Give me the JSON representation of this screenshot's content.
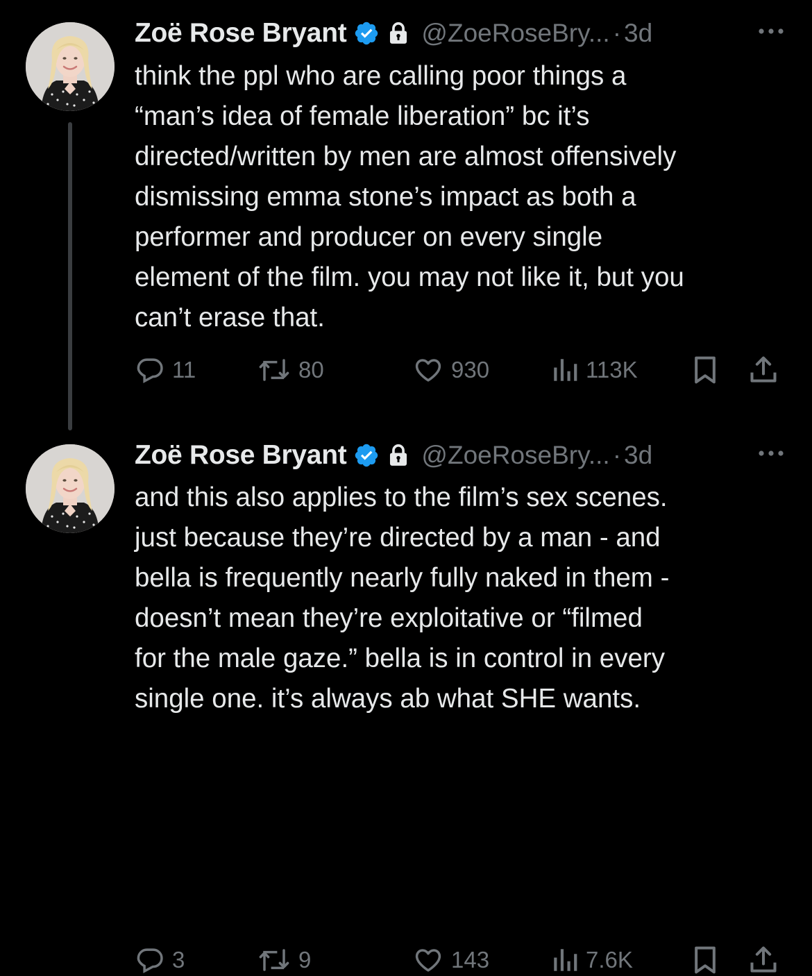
{
  "tweets": [
    {
      "author": {
        "display_name": "Zoë Rose Bryant",
        "handle": "@ZoeRoseBry...",
        "verified_icon": "verified-badge-icon",
        "locked_icon": "lock-icon"
      },
      "separator": "·",
      "time": "3d",
      "text_lines": [
        "think the ppl who are calling poor things a",
        "“man’s idea of female liberation” bc it’s",
        "directed/written by men are almost offensively",
        "dismissing emma stone’s impact as both a",
        "performer and producer on every single",
        "element of the film. you may not like it, but you",
        "can’t erase that."
      ],
      "stats": {
        "replies": "11",
        "reposts": "80",
        "likes": "930",
        "views": "113K"
      }
    },
    {
      "author": {
        "display_name": "Zoë Rose Bryant",
        "handle": "@ZoeRoseBry...",
        "verified_icon": "verified-badge-icon",
        "locked_icon": "lock-icon"
      },
      "separator": "·",
      "time": "3d",
      "text_lines": [
        "and this also applies to the film’s sex scenes.",
        "just because they’re directed by a man - and",
        "bella is frequently nearly fully naked in them -",
        "doesn’t mean they’re exploitative or “filmed",
        "for the male gaze.” bella is in control in every",
        "single one. it’s always ab what SHE wants."
      ],
      "stats": {
        "replies": "3",
        "reposts": "9",
        "likes": "143",
        "views": "7.6K"
      }
    }
  ],
  "colors": {
    "background": "#000000",
    "primary_text": "#e7e9ea",
    "secondary_text": "#71767b",
    "verified_blue": "#1d9bf0",
    "thread_line": "#3a3d40"
  }
}
